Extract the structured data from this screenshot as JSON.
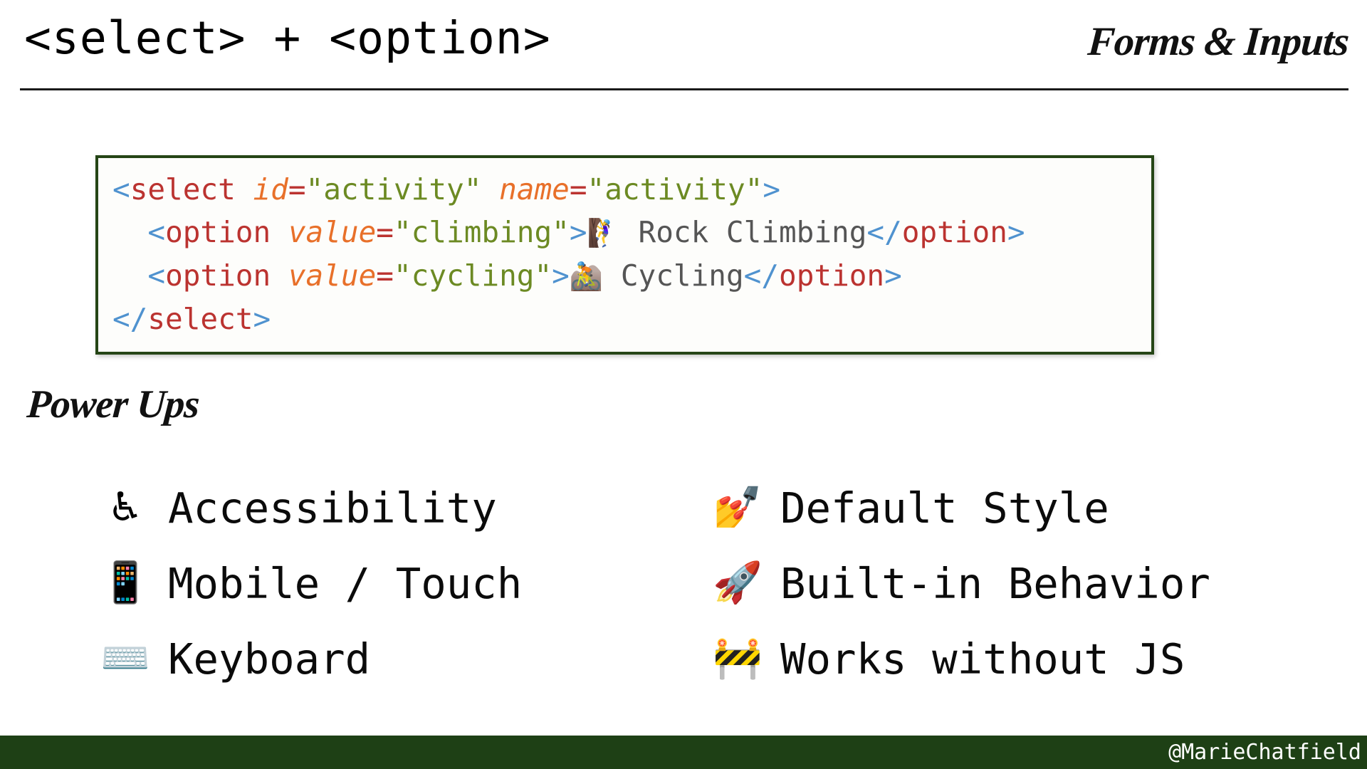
{
  "header": {
    "title": "<select> + <option>",
    "kicker": "Forms & Inputs"
  },
  "code_block": {
    "language": "html",
    "border_color": "#254516",
    "colors": {
      "punctuation": "#4f92cf",
      "tag": "#bb3330",
      "attribute": "#e8702a",
      "string": "#6c8a23",
      "text": "#555555"
    },
    "lines": [
      {
        "indent": "",
        "tokens": [
          {
            "t": "punc",
            "v": "<"
          },
          {
            "t": "tag",
            "v": "select"
          },
          {
            "t": "text",
            "v": " "
          },
          {
            "t": "attr",
            "v": "id"
          },
          {
            "t": "eq",
            "v": "="
          },
          {
            "t": "str",
            "v": "\"activity\""
          },
          {
            "t": "text",
            "v": " "
          },
          {
            "t": "attr",
            "v": "name"
          },
          {
            "t": "eq",
            "v": "="
          },
          {
            "t": "str",
            "v": "\"activity\""
          },
          {
            "t": "punc",
            "v": ">"
          }
        ]
      },
      {
        "indent": "  ",
        "tokens": [
          {
            "t": "punc",
            "v": "<"
          },
          {
            "t": "tag",
            "v": "option"
          },
          {
            "t": "text",
            "v": " "
          },
          {
            "t": "attr",
            "v": "value"
          },
          {
            "t": "eq",
            "v": "="
          },
          {
            "t": "str",
            "v": "\"climbing\""
          },
          {
            "t": "punc",
            "v": ">"
          },
          {
            "t": "emoji",
            "v": "🧗‍♀️"
          },
          {
            "t": "content",
            "v": " Rock Climbing"
          },
          {
            "t": "punc",
            "v": "</"
          },
          {
            "t": "tag",
            "v": "option"
          },
          {
            "t": "punc",
            "v": ">"
          }
        ]
      },
      {
        "indent": "  ",
        "tokens": [
          {
            "t": "punc",
            "v": "<"
          },
          {
            "t": "tag",
            "v": "option"
          },
          {
            "t": "text",
            "v": " "
          },
          {
            "t": "attr",
            "v": "value"
          },
          {
            "t": "eq",
            "v": "="
          },
          {
            "t": "str",
            "v": "\"cycling\""
          },
          {
            "t": "punc",
            "v": ">"
          },
          {
            "t": "emoji",
            "v": "🚵"
          },
          {
            "t": "content",
            "v": " Cycling"
          },
          {
            "t": "punc",
            "v": "</"
          },
          {
            "t": "tag",
            "v": "option"
          },
          {
            "t": "punc",
            "v": ">"
          }
        ]
      },
      {
        "indent": "",
        "tokens": [
          {
            "t": "punc",
            "v": "</"
          },
          {
            "t": "tag",
            "v": "select"
          },
          {
            "t": "punc",
            "v": ">"
          }
        ]
      }
    ]
  },
  "power_ups": {
    "heading": "Power Ups",
    "items": [
      {
        "icon": "♿",
        "icon_name": "accessibility-icon",
        "label": "Accessibility"
      },
      {
        "icon": "💅",
        "icon_name": "nail-polish-icon",
        "label": "Default Style"
      },
      {
        "icon": "📱",
        "icon_name": "mobile-phone-icon",
        "label": "Mobile / Touch"
      },
      {
        "icon": "🚀",
        "icon_name": "rocket-icon",
        "label": "Built-in Behavior"
      },
      {
        "icon": "⌨️",
        "icon_name": "keyboard-icon",
        "label": "Keyboard"
      },
      {
        "icon": "🚧",
        "icon_name": "construction-icon",
        "label": "Works without JS"
      }
    ]
  },
  "footer": {
    "handle": "@MarieChatfield",
    "background_color": "#1e4015"
  }
}
